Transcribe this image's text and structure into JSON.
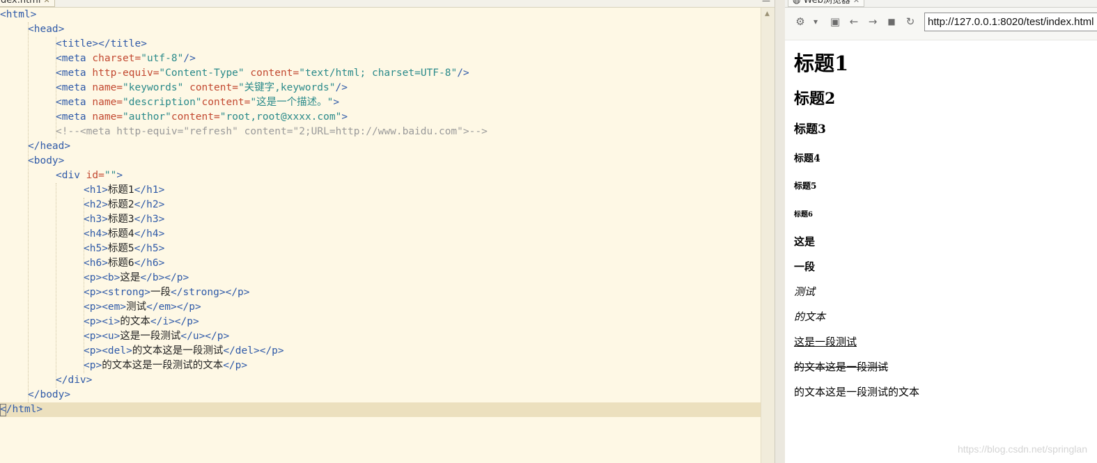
{
  "editor": {
    "tab_label": "dex.html",
    "tab_close": "✕",
    "minimize": "—",
    "lines": [
      [
        "",
        "<html>",
        "",
        "",
        ""
      ],
      [
        "",
        "",
        "",
        "",
        ""
      ]
    ],
    "code": {
      "l1_tag": "<html>",
      "l2_tag": "<head>",
      "l3_open": "<title>",
      "l3_close": "</title>",
      "l4_tag": "<meta ",
      "l4_attr": "charset=",
      "l4_val": "\"utf-8\"",
      "l4_end": "/>",
      "l5_tag": "<meta ",
      "l5_attr1": "http-equiv=",
      "l5_val1": "\"Content-Type\"",
      "l5_attr2": " content=",
      "l5_val2": "\"text/html; charset=UTF-8\"",
      "l5_end": "/>",
      "l6_tag": "<meta ",
      "l6_attr1": "name=",
      "l6_val1": "\"keywords\"",
      "l6_attr2": " content=",
      "l6_val2": "\"关键字,keywords\"",
      "l6_end": "/>",
      "l7_tag": "<meta ",
      "l7_attr1": "name=",
      "l7_val1": "\"description\"",
      "l7_attr2": "content=",
      "l7_val2": "\"这是一个描述。\"",
      "l7_end": ">",
      "l8_tag": "<meta ",
      "l8_attr1": "name=",
      "l8_val1": "\"author\"",
      "l8_attr2": "content=",
      "l8_val2": "\"root,root@xxxx.com\"",
      "l8_end": ">",
      "l9_comment": "<!--<meta http-equiv=\"refresh\" content=\"2;URL=http://www.baidu.com\">-->",
      "l10_tag": "</head>",
      "l11_tag": "<body>",
      "l12_tag": "<div ",
      "l12_attr": "id=",
      "l12_val": "\"\"",
      "l12_end": ">",
      "l13_o": "<h1>",
      "l13_t": "标题1",
      "l13_c": "</h1>",
      "l14_o": "<h2>",
      "l14_t": "标题2",
      "l14_c": "</h2>",
      "l15_o": "<h3>",
      "l15_t": "标题3",
      "l15_c": "</h3>",
      "l16_o": "<h4>",
      "l16_t": "标题4",
      "l16_c": "</h4>",
      "l17_o": "<h5>",
      "l17_t": "标题5",
      "l17_c": "</h5>",
      "l18_o": "<h6>",
      "l18_t": "标题6",
      "l18_c": "</h6>",
      "l19_o": "<p><b>",
      "l19_t": "这是",
      "l19_c": "</b></p>",
      "l20_o": "<p><strong>",
      "l20_t": "一段",
      "l20_c": "</strong></p>",
      "l21_o": "<p><em>",
      "l21_t": "测试",
      "l21_c": "</em></p>",
      "l22_o": "<p><i>",
      "l22_t": "的文本",
      "l22_c": "</i></p>",
      "l23_o": "<p><u>",
      "l23_t": "这是一段测试",
      "l23_c": "</u></p>",
      "l24_o": "<p><del>",
      "l24_t": "的文本这是一段测试",
      "l24_c": "</del></p>",
      "l25_o": "<p>",
      "l25_t": "的文本这是一段测试的文本",
      "l25_c": "</p>",
      "l26_tag": "</div>",
      "l27_tag": "</body>",
      "l28_tag": "</html>"
    }
  },
  "browser": {
    "tab_label": "Web浏览器",
    "tab_close": "✕",
    "toolbar": {
      "settings_icon": "⚙",
      "dropdown_icon": "▾",
      "console_icon": "▣",
      "back_icon": "←",
      "forward_icon": "→",
      "stop_icon": "■",
      "refresh_icon": "↻"
    },
    "url": "http://127.0.0.1:8020/test/index.html",
    "preview": {
      "h1": "标题1",
      "h2": "标题2",
      "h3": "标题3",
      "h4": "标题4",
      "h5": "标题5",
      "h6": "标题6",
      "p_bold": "这是",
      "p_strong": "一段",
      "p_em": "测试",
      "p_i": "的文本",
      "p_u": "这是一段测试",
      "p_del": "的文本这是一段测试",
      "p_plain": "的文本这是一段测试的文本"
    },
    "watermark": "https://blog.csdn.net/springlan"
  }
}
